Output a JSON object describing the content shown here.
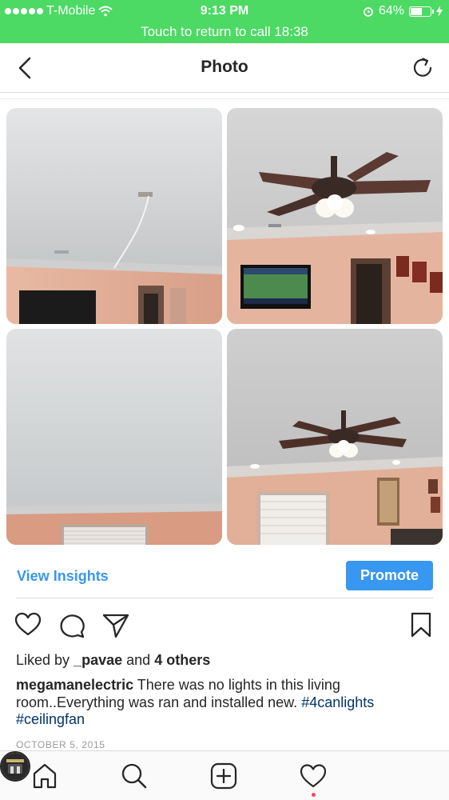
{
  "status_bar": {
    "carrier": "T-Mobile",
    "time": "9:13 PM",
    "battery_percent": "64%",
    "battery_level": 0.64
  },
  "call_banner": {
    "text": "Touch to return to call 18:38"
  },
  "nav": {
    "title": "Photo"
  },
  "insights": {
    "view_insights_label": "View Insights",
    "promote_label": "Promote"
  },
  "post": {
    "liked_by_prefix": "Liked by",
    "liked_by_user": "_pavae",
    "liked_by_and": "and",
    "liked_by_others": "4 others",
    "caption_user": "megamanelectric",
    "caption_text": "There was no lights in this living room..Everything was ran and installed new.",
    "hashtag_1": "#4canlights",
    "hashtag_2": "#ceilingfan",
    "date": "OCTOBER 5, 2015"
  },
  "photos": [
    {
      "name": "ceiling-wires-photo",
      "subject": "ceiling with hanging wire"
    },
    {
      "name": "ceiling-fan-tv-photo",
      "subject": "ceiling fan with lights above TV"
    },
    {
      "name": "plain-ceiling-photo",
      "subject": "textured ceiling above window"
    },
    {
      "name": "ceiling-fan-window-photo",
      "subject": "ceiling fan above window"
    }
  ],
  "colors": {
    "status_green": "#4cd964",
    "accent_blue": "#3897f0",
    "hashtag_blue": "#003569",
    "notification_red": "#ed4956"
  },
  "icons": {
    "back": "chevron-left-icon",
    "refresh": "refresh-icon",
    "like": "heart-icon",
    "comment": "comment-icon",
    "share": "paper-plane-icon",
    "save": "bookmark-icon",
    "home": "home-icon",
    "search": "search-icon",
    "add": "plus-square-icon",
    "activity": "heart-icon",
    "profile": "avatar"
  }
}
